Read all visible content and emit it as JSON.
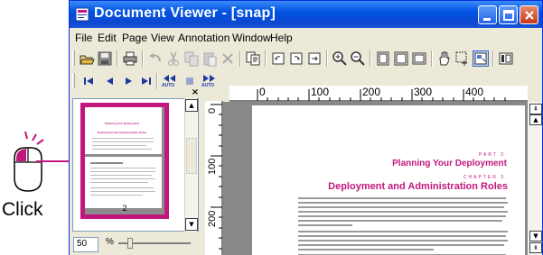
{
  "callout": {
    "label": "Click",
    "accent": "#c2187e"
  },
  "window": {
    "title": "Document Viewer - [snap]",
    "title_color": "#0054e3",
    "controls": [
      "minimize-icon",
      "maximize-icon",
      "close-icon"
    ]
  },
  "menu": [
    "File",
    "Edit",
    "Page",
    "View",
    "Annotation",
    "Window",
    "Help"
  ],
  "toolbar1": [
    "open-icon",
    "save-icon",
    "print-icon",
    "undo-icon",
    "cut-icon",
    "copy-icon",
    "paste-icon",
    "delete-icon",
    "page-copy-icon",
    "rotate-left-icon",
    "rotate-right-icon",
    "fit-icon",
    "zoom-in-icon",
    "zoom-out-icon",
    "one-page-icon",
    "two-page-icon",
    "full-page-icon",
    "hand-icon",
    "select-icon",
    "snapshot-icon",
    "panel-icon"
  ],
  "toolbar2": {
    "buttons": [
      "first-page-icon",
      "prev-page-icon",
      "next-page-icon",
      "last-page-icon",
      "auto-back-icon",
      "stop-icon",
      "auto-forward-icon"
    ],
    "auto_label": "AUTO"
  },
  "thumbnails": {
    "page_number": "2",
    "zoom": "50",
    "zoom_unit": "%"
  },
  "ruler": {
    "h_labels": [
      "0",
      "100",
      "200",
      "300",
      "400"
    ],
    "v_labels": [
      "0",
      "100",
      "200"
    ]
  },
  "document": {
    "part_label": "PART 2",
    "part_title": "Planning Your Deployment",
    "chapter_label": "CHAPTER 3",
    "chapter_title": "Deployment and Administration Roles",
    "thumb_title1": "Planning Your Deployment",
    "thumb_title2": "Deployment and Administration Roles"
  }
}
